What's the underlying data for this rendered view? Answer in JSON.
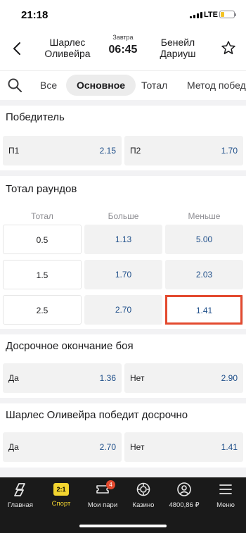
{
  "status": {
    "time": "21:18",
    "network": "LTE",
    "battery_color": "#f3c327"
  },
  "header": {
    "team1": "Шарлес Оливейра",
    "team2": "Бенейл Дариуш",
    "day": "Завтра",
    "time": "06:45"
  },
  "tabs": [
    "Все",
    "Основное",
    "Тотал",
    "Метод победы"
  ],
  "active_tab": "Основное",
  "winner": {
    "title": "Победитель",
    "options": [
      {
        "label": "П1",
        "odd": "2.15"
      },
      {
        "label": "П2",
        "odd": "1.70"
      }
    ]
  },
  "total_rounds": {
    "title": "Тотал раундов",
    "headers": [
      "Тотал",
      "Больше",
      "Меньше"
    ],
    "rows": [
      {
        "total": "0.5",
        "over": "1.13",
        "under": "5.00"
      },
      {
        "total": "1.5",
        "over": "1.70",
        "under": "2.03"
      },
      {
        "total": "2.5",
        "over": "2.70",
        "under": "1.41"
      }
    ]
  },
  "early_finish": {
    "title": "Досрочное окончание боя",
    "options": [
      {
        "label": "Да",
        "odd": "1.36"
      },
      {
        "label": "Нет",
        "odd": "2.90"
      }
    ]
  },
  "early_win": {
    "title": "Шарлес Оливейра победит досрочно",
    "options": [
      {
        "label": "Да",
        "odd": "2.70"
      },
      {
        "label": "Нет",
        "odd": "1.41"
      }
    ]
  },
  "nav": {
    "items": [
      "Главная",
      "Спорт",
      "Мои пари",
      "Казино",
      "4800,86 ₽",
      "Меню"
    ],
    "active": "Спорт",
    "score_icon": "2:1",
    "bets_badge": "4"
  },
  "colors": {
    "accent": "#f3d530",
    "odds": "#1f4f8a",
    "highlight": "#e34a2f",
    "nav_bg": "#1a1a1a"
  }
}
